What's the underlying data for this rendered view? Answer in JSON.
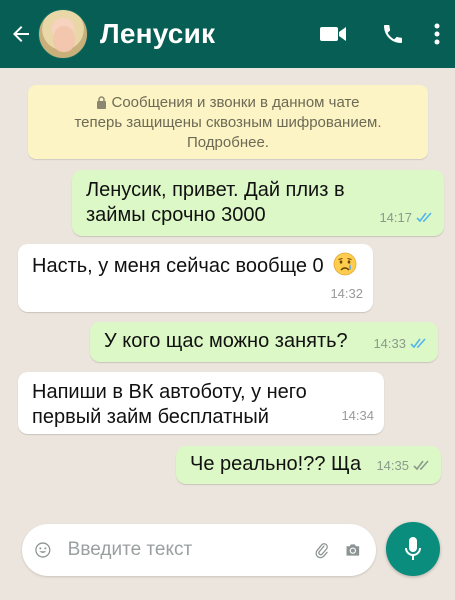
{
  "header": {
    "contact_name": "Ленусик",
    "icons": [
      "back-arrow-icon",
      "video-call-icon",
      "phone-icon",
      "more-vert-icon"
    ]
  },
  "notice": {
    "line1": "Сообщения и звонки в данном чате",
    "line2": "теперь защищены сквозным шифрованием.",
    "line3": "Подробнее."
  },
  "messages": [
    {
      "direction": "out",
      "lines": [
        "Ленусик, привет. Дай плиз в",
        "займы срочно 3000"
      ],
      "time": "14:17",
      "status": "read"
    },
    {
      "direction": "in",
      "lines": [
        "Насть, у меня сейчас вообще 0"
      ],
      "emoji": "crying-face",
      "time": "14:32"
    },
    {
      "direction": "out",
      "lines": [
        "У кого щас можно занять?"
      ],
      "time": "14:33",
      "status": "read"
    },
    {
      "direction": "in",
      "lines": [
        "Напиши в ВК автоботу, у него",
        "первый займ бесплатный"
      ],
      "time": "14:34"
    },
    {
      "direction": "out",
      "lines": [
        "Че реально!?? Ща"
      ],
      "time": "14:35",
      "status": "delivered"
    }
  ],
  "composer": {
    "placeholder": "Введите текст"
  },
  "colors": {
    "header": "#075E54",
    "background": "#ECE5DD",
    "outgoing_bubble": "#DCF8C6",
    "incoming_bubble": "#FFFFFF",
    "read_ticks": "#4FB6EC",
    "delivered_ticks": "#8a9a8c",
    "mic_button": "#0B8D7D"
  }
}
